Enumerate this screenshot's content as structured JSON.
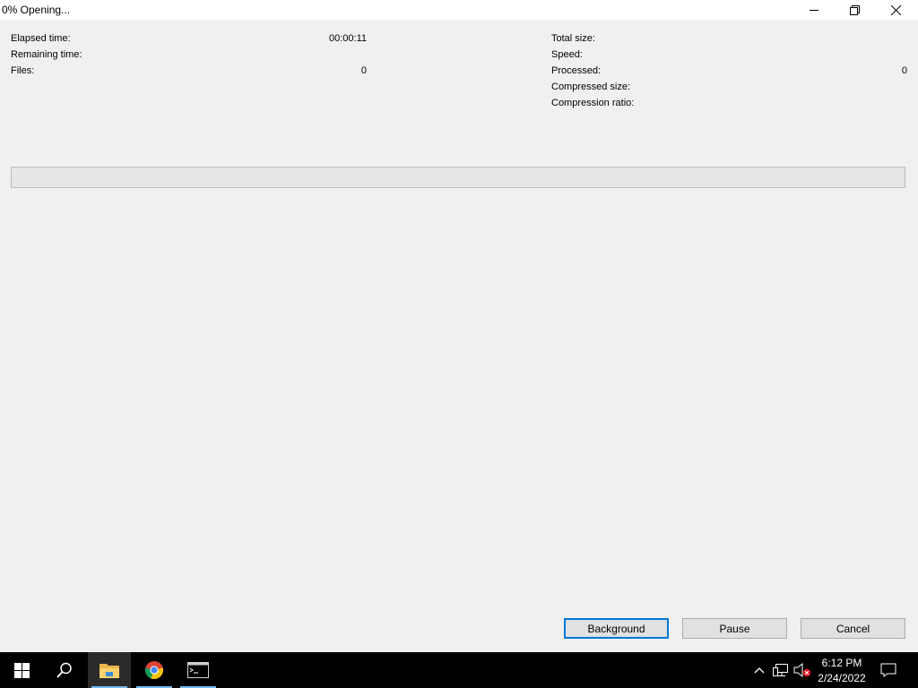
{
  "window": {
    "title": "0% Opening..."
  },
  "stats": {
    "left": [
      {
        "label": "Elapsed time:",
        "value": "00:00:11"
      },
      {
        "label": "Remaining time:",
        "value": ""
      },
      {
        "label": "Files:",
        "value": "0"
      }
    ],
    "right": [
      {
        "label": "Total size:",
        "value": ""
      },
      {
        "label": "Speed:",
        "value": ""
      },
      {
        "label": "Processed:",
        "value": "0"
      },
      {
        "label": "Compressed size:",
        "value": ""
      },
      {
        "label": "Compression ratio:",
        "value": ""
      }
    ]
  },
  "progress": {
    "percent": 0
  },
  "buttons": {
    "background": "Background",
    "pause": "Pause",
    "cancel": "Cancel"
  },
  "taskbar": {
    "time": "6:12 PM",
    "date": "2/24/2022",
    "icons": [
      "windows-start-icon",
      "search-icon",
      "file-explorer-icon",
      "chrome-icon",
      "terminal-icon",
      "chevron-up-icon",
      "network-icon",
      "volume-muted-icon",
      "notification-icon"
    ]
  },
  "colors": {
    "accent": "#0078d7",
    "taskbar": "#000000",
    "dialog_bg": "#f0f0f0"
  }
}
